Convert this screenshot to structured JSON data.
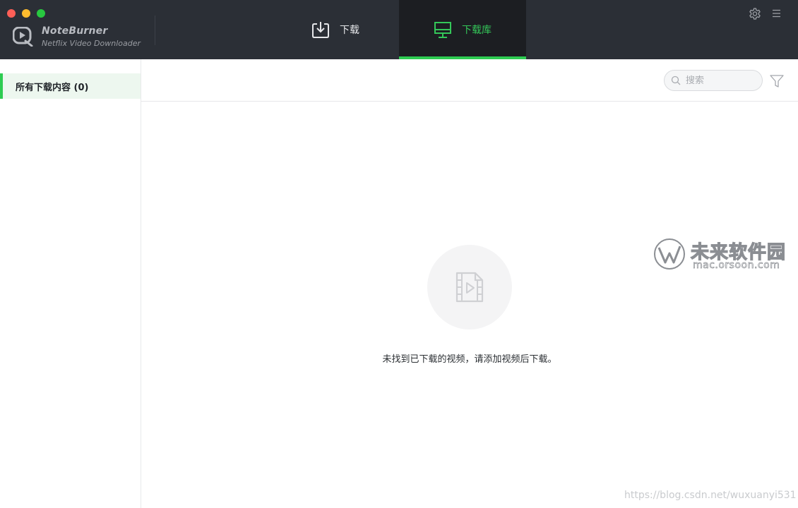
{
  "app": {
    "name": "NoteBurner",
    "subtitle": "Netflix Video Downloader"
  },
  "nav": {
    "tabs": [
      {
        "label": "下载",
        "icon": "download-icon",
        "active": false
      },
      {
        "label": "下载库",
        "icon": "library-monitor-icon",
        "active": true
      }
    ]
  },
  "header_icons": [
    "gear-icon",
    "menu-icon"
  ],
  "sidebar": {
    "items": [
      {
        "label": "所有下载内容 (0)",
        "selected": true
      }
    ]
  },
  "search": {
    "value": "",
    "placeholder": "搜索"
  },
  "empty_state": {
    "icon": "video-file-icon",
    "message": "未找到已下载的视频，请添加视频后下载。"
  },
  "watermark": {
    "title": "未来软件园",
    "url": "mac.orsoon.com",
    "csdn": "https://blog.csdn.net/wuxuanyi531"
  },
  "colors": {
    "header_bg": "#2b2f36",
    "accent_green": "#2ecc52",
    "active_tab_bg": "#1c1e22",
    "sidebar_selected_bg": "#edf7ef"
  }
}
